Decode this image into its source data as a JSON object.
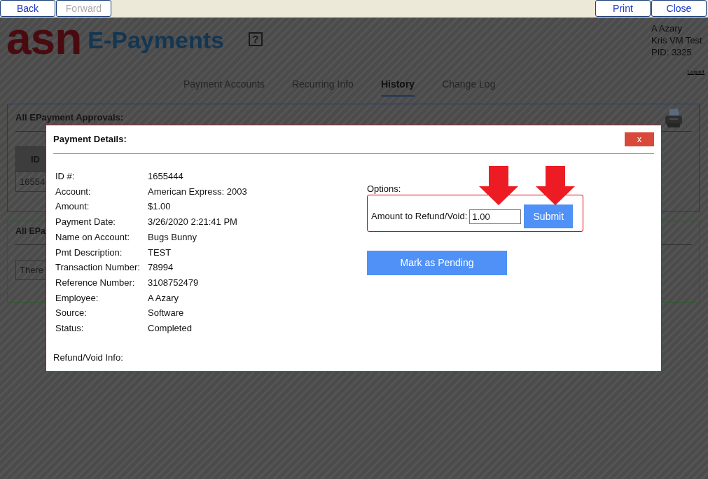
{
  "toolbar": {
    "left_buttons": [
      {
        "label": "Back",
        "disabled": false
      },
      {
        "label": "Forward",
        "disabled": true
      }
    ],
    "right_buttons": [
      {
        "label": "Print",
        "disabled": false
      },
      {
        "label": "Close",
        "disabled": false
      }
    ]
  },
  "header": {
    "logo_mark": "asn",
    "logo_text": "E-Payments",
    "help": "?",
    "user_lines": [
      "A Azary",
      "Kris VM Test",
      "PID: 3325"
    ],
    "logout": "Logout"
  },
  "nav": [
    {
      "label": "Payment Accounts",
      "selected": false
    },
    {
      "label": "Recurring Info",
      "selected": false
    },
    {
      "label": "History",
      "selected": true
    },
    {
      "label": "Change Log",
      "selected": false
    }
  ],
  "panels": [
    {
      "kind": "table",
      "title": "All EPayment Approvals:",
      "print_icon": true,
      "columns": [
        "ID"
      ],
      "rows": [
        [
          "16554"
        ]
      ]
    },
    {
      "kind": "message",
      "title": "All EPa",
      "print_icon": false,
      "message": "There"
    }
  ],
  "dialog": {
    "title": "Payment Details:",
    "close": "x",
    "details": [
      {
        "label": "ID #:",
        "value": "1655444"
      },
      {
        "label": "Account:",
        "value": "American Express: 2003"
      },
      {
        "label": "Amount:",
        "value": "$1.00"
      },
      {
        "label": "Payment Date:",
        "value": "3/26/2020 2:21:41 PM"
      },
      {
        "label": "Name on Account:",
        "value": "Bugs Bunny"
      },
      {
        "label": "Pmt Description:",
        "value": "TEST"
      },
      {
        "label": "Transaction Number:",
        "value": "78994"
      },
      {
        "label": "Reference Number:",
        "value": "3108752479"
      },
      {
        "label": "Employee:",
        "value": "A Azary"
      },
      {
        "label": "Source:",
        "value": "Software"
      },
      {
        "label": "Status:",
        "value": "Completed"
      }
    ],
    "footer_label": "Refund/Void Info:",
    "options": {
      "label": "Options:",
      "amount_label": "Amount to Refund/Void:",
      "amount_value": "1.00",
      "submit": "Submit"
    },
    "pending_button": "Mark as Pending"
  }
}
